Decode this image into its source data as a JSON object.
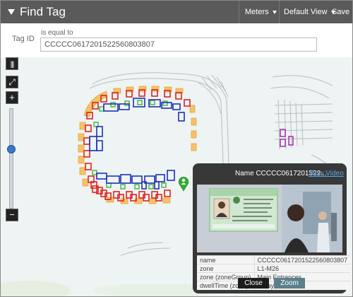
{
  "header": {
    "title": "Find Tag",
    "units_menu": "Meters",
    "view_menu": "Default View",
    "save_label": "Save"
  },
  "filter": {
    "field_label": "Tag ID",
    "operator_label": "is equal to",
    "value": "CCCCC0617201522560803807"
  },
  "map": {
    "controls": {
      "layers_icon": "layers-icon",
      "fullscreen_icon": "expand-icon",
      "zoom_in": "+",
      "zoom_out": "−"
    },
    "zoom_level_fraction": 0.4,
    "marker_icon": "person-pin-icon"
  },
  "popup": {
    "name_label": "Name CCCCC0617201522...",
    "video_link": "View Video",
    "rows": [
      {
        "key": "name",
        "value": "CCCCC0617201522560803807"
      },
      {
        "key": "zone",
        "value": "L1-M26"
      },
      {
        "key": "zone (zoneGroup)",
        "value": "Main Entrances"
      },
      {
        "key": "dwellTime (zone)",
        "value": "0 Days 03:11:41"
      }
    ],
    "close_label": "Close",
    "zoom_label": "Zoom"
  },
  "colors": {
    "header_bg": "#5a5a5a",
    "map_bg": "#eef4f3",
    "popup_bg": "#383838",
    "link": "#5aa8ea",
    "marker": "#3aa63a",
    "zoom_button": "#5b7f8c"
  }
}
